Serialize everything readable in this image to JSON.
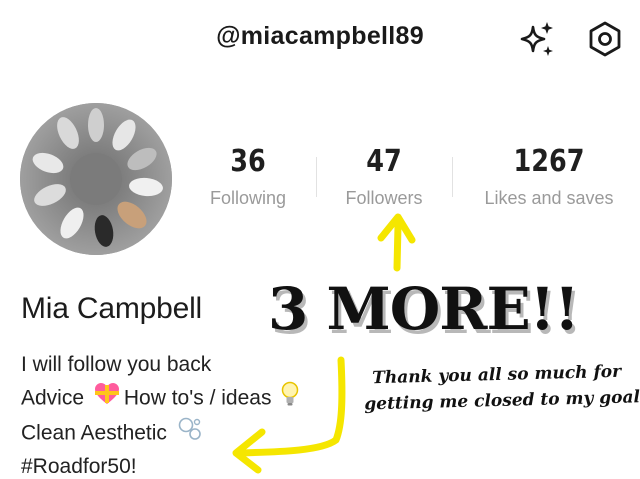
{
  "header": {
    "username": "@miacampbell89",
    "sparkle_icon": "sparkle-icon",
    "settings_icon": "hexagon-settings-icon"
  },
  "stats": [
    {
      "value": "36",
      "label": "Following"
    },
    {
      "value": "47",
      "label": "Followers"
    },
    {
      "value": "1267",
      "label": "Likes and saves"
    }
  ],
  "profile": {
    "name": "Mia Campbell",
    "bio": [
      "I will follow you back",
      "Advice ",
      "How to's / ideas ",
      "Clean Aesthetic ",
      "#Roadfor50!"
    ],
    "bio_icons": [
      "heart-gift-icon",
      "lightbulb-icon",
      "bubbles-icon"
    ]
  },
  "overlay": {
    "headline": "3 MORE!!",
    "thanks_line1": "Thank you all so much for",
    "thanks_line2": "getting me closed to my goals!",
    "arrow_color": "#f5e600"
  }
}
